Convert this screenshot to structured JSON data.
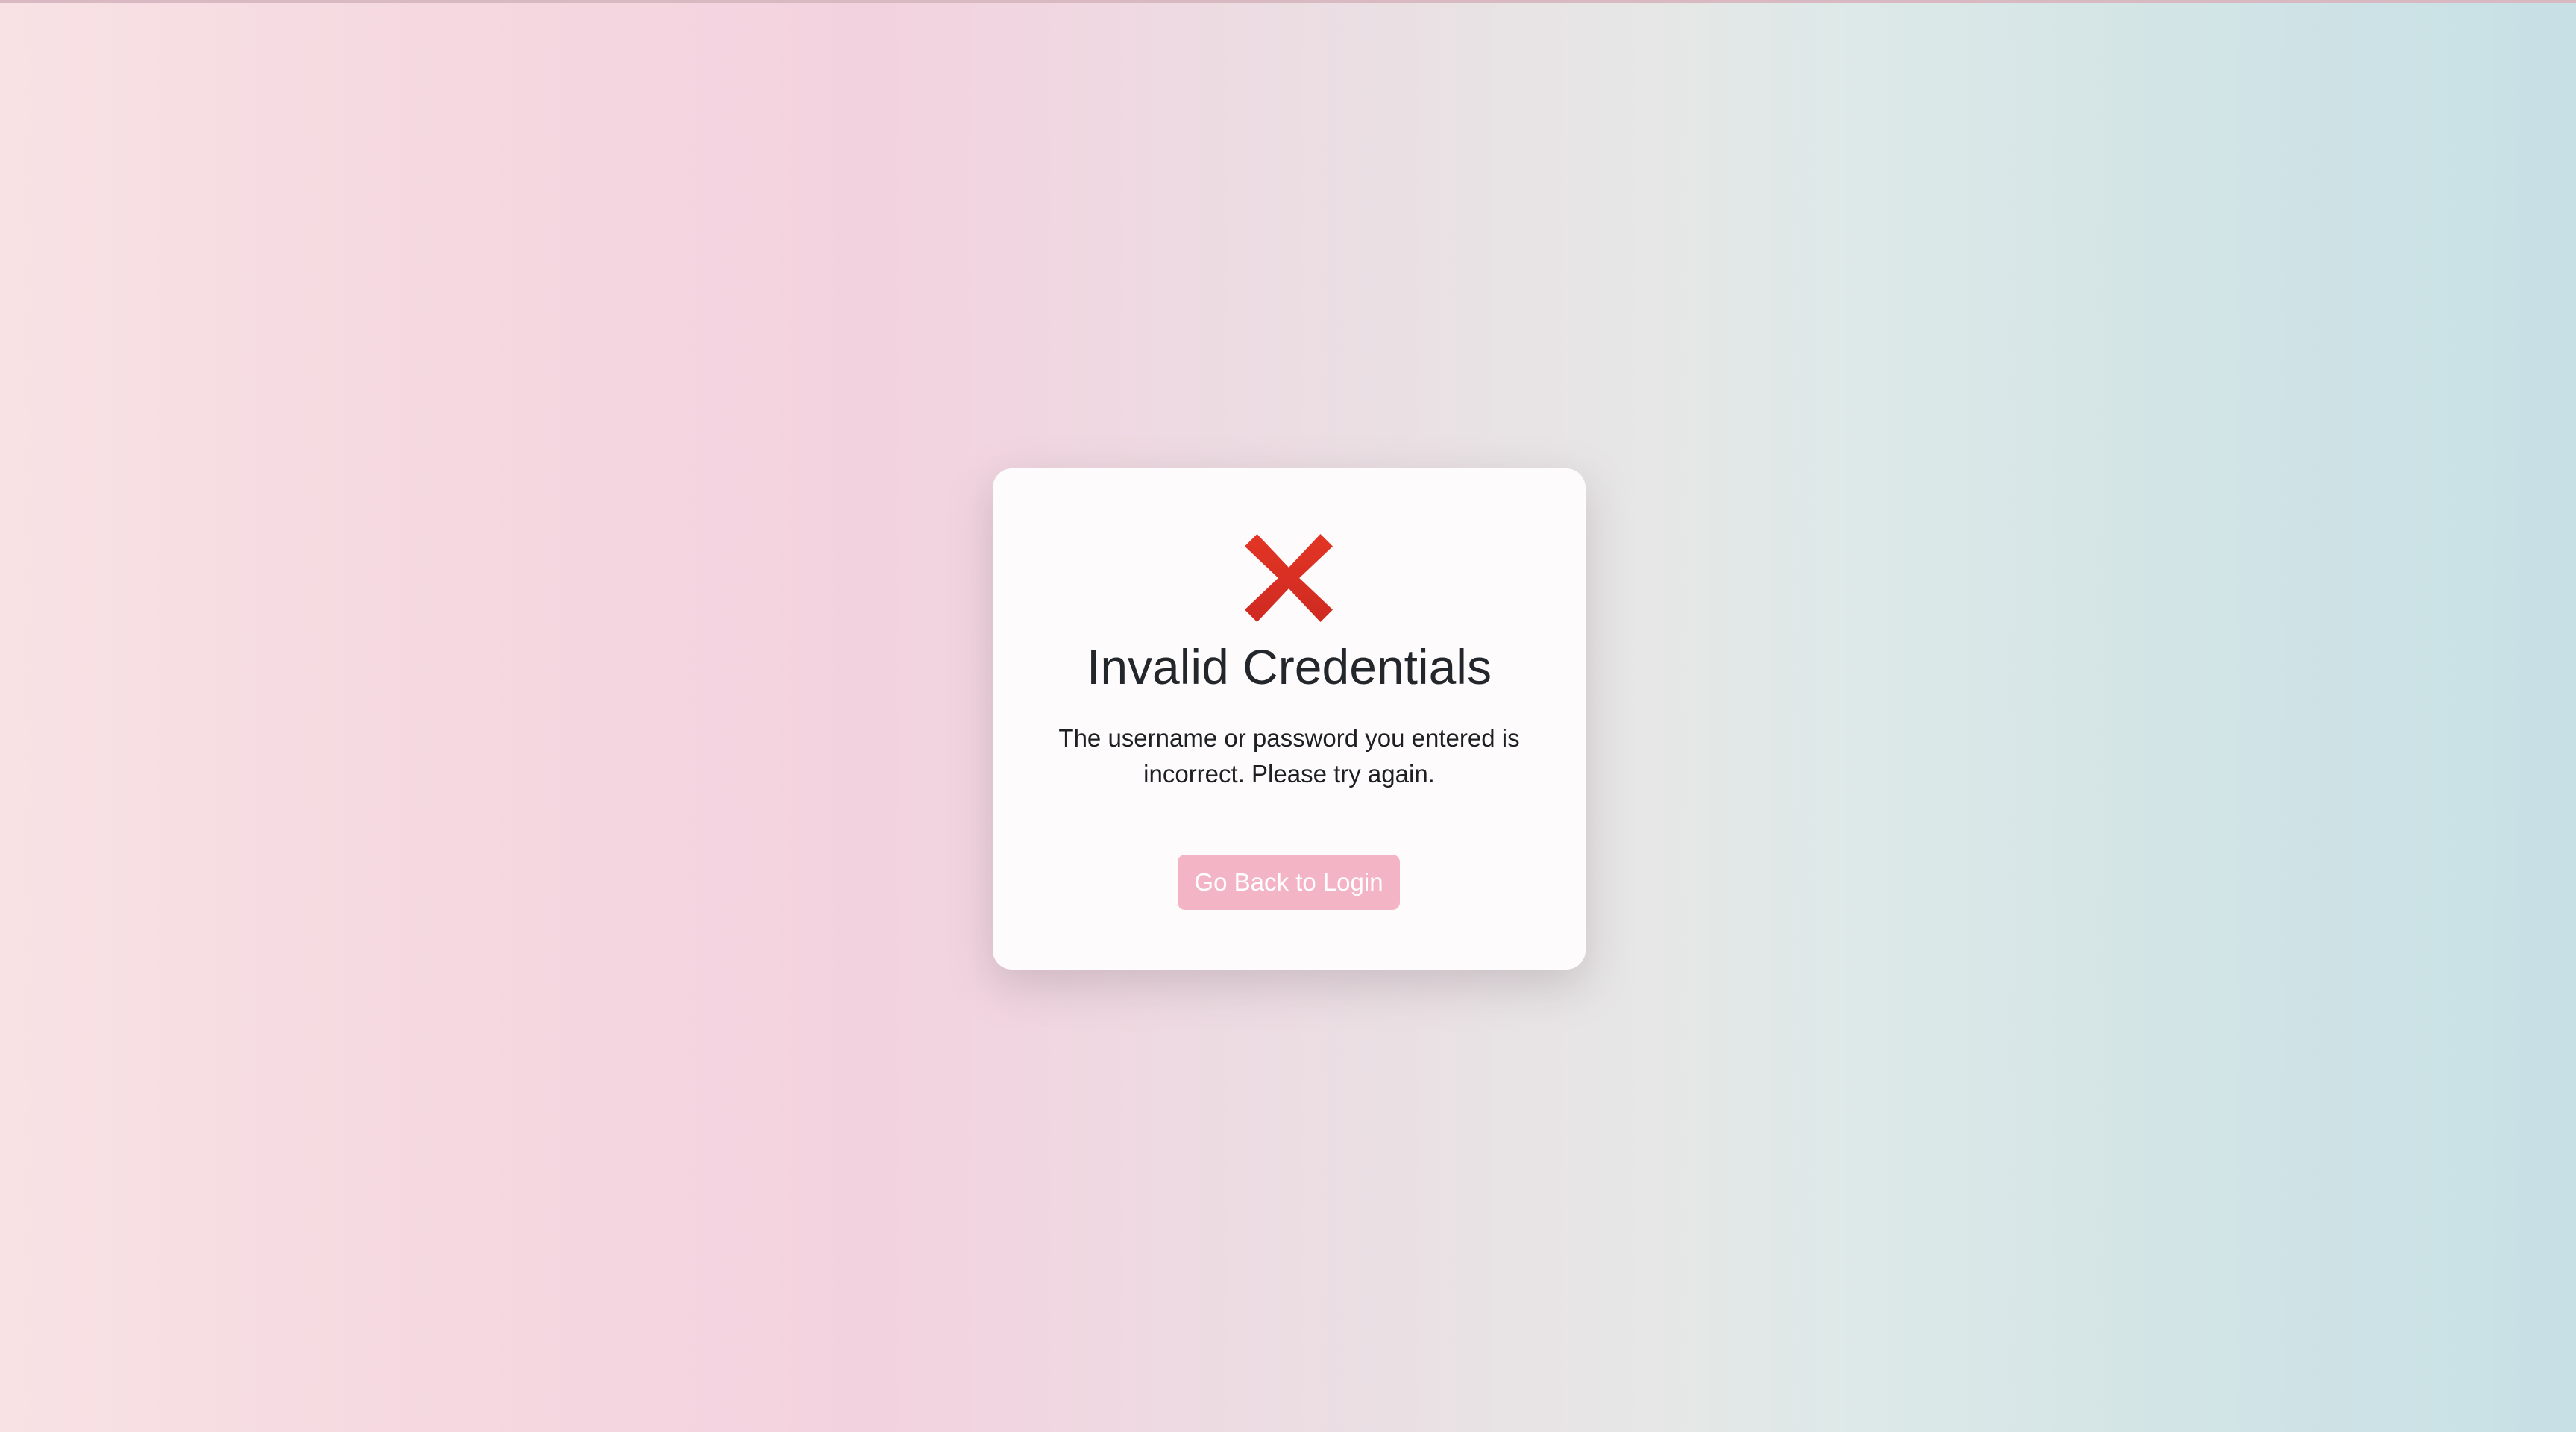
{
  "error": {
    "icon": "cross-mark-icon",
    "title": "Invalid Credentials",
    "message": "The username or password you entered is incorrect. Please try again.",
    "button_label": "Go Back to Login"
  },
  "colors": {
    "icon_red": "#d93025",
    "button_bg": "#f3b5c6"
  }
}
